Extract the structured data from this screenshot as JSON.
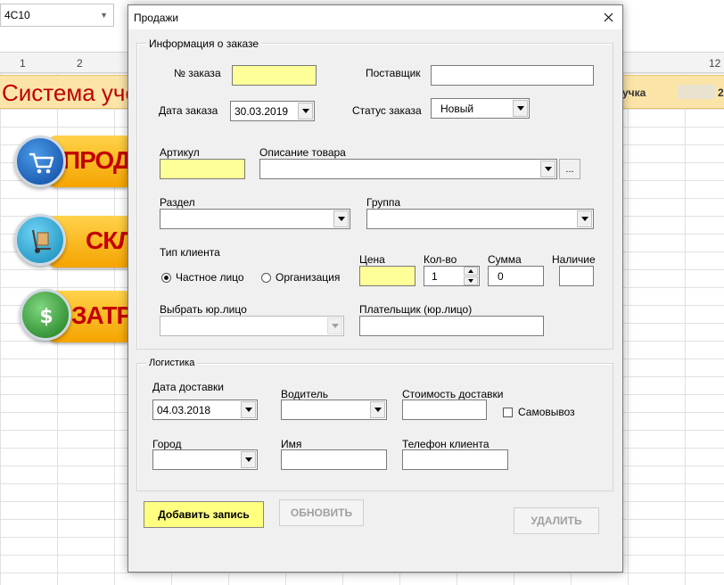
{
  "excel": {
    "name_box": "4C10",
    "column_headers": [
      "1",
      "2",
      "12"
    ],
    "banner_title": "Система учё",
    "banner_right_text": "учка",
    "banner_right_num": "2",
    "buttons": [
      {
        "label": "ПРОД",
        "icon": "cart-icon",
        "color": "#1565c0"
      },
      {
        "label": "СКЛ",
        "icon": "hand-truck-icon",
        "color": "#20a8d8"
      },
      {
        "label": "ЗАТР",
        "icon": "dollar-icon",
        "color": "#43a047"
      }
    ]
  },
  "dialog": {
    "title": "Продажи",
    "order_info": {
      "legend": "Информация о заказе",
      "order_no_label": "№ заказа",
      "order_no_value": "",
      "supplier_label": "Поставщик",
      "supplier_value": "",
      "order_date_label": "Дата заказа",
      "order_date_value": "30.03.2019",
      "order_status_label": "Статус заказа",
      "order_status_value": "Новый",
      "article_label": "Артикул",
      "article_value": "",
      "description_label": "Описание товара",
      "description_value": "",
      "browse_label": "...",
      "section_label": "Раздел",
      "section_value": "",
      "group_label": "Группа",
      "group_value": "",
      "client_type_label": "Тип клиента",
      "client_private_label": "Частное лицо",
      "client_org_label": "Организация",
      "price_label": "Цена",
      "price_value": "",
      "qty_label": "Кол-во",
      "qty_value": "1",
      "sum_label": "Сумма",
      "sum_value": "0",
      "stock_label": "Наличие",
      "stock_value": "",
      "legal_entity_label": "Выбрать юр.лицо",
      "legal_entity_value": "",
      "payer_label": "Плательщик (юр.лицо)",
      "payer_value": ""
    },
    "logistics": {
      "legend": "Логистика",
      "delivery_date_label": "Дата доставки",
      "delivery_date_value": "04.03.2018",
      "driver_label": "Водитель",
      "driver_value": "",
      "delivery_cost_label": "Стоимость доставки",
      "delivery_cost_value": "",
      "pickup_label": "Самовывоз",
      "city_label": "Город",
      "city_value": "",
      "name_label": "Имя",
      "name_value": "",
      "phone_label": "Телефон клиента",
      "phone_value": ""
    },
    "buttons": {
      "add": "Добавить запись",
      "update": "ОБНОВИТЬ",
      "delete": "УДАЛИТЬ"
    }
  },
  "colors": {
    "yellow_field": "#ffff99",
    "add_button": "#ffff80",
    "banner": "#fbe4a8",
    "banner_text": "#c00000"
  }
}
